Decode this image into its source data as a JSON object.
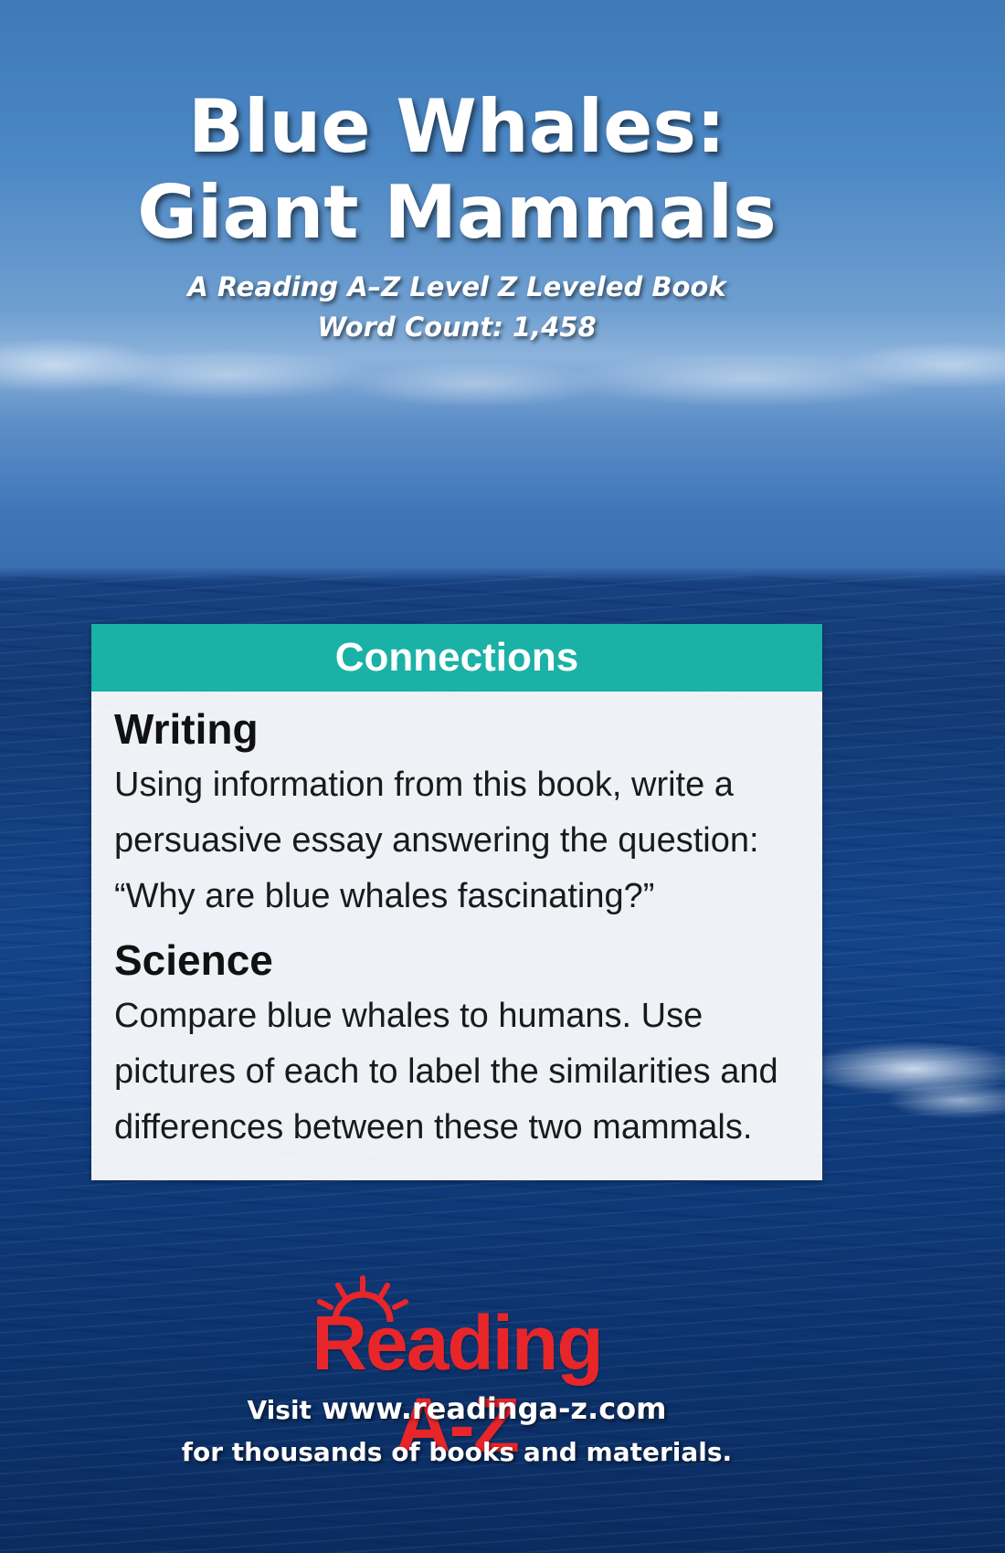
{
  "cover": {
    "title_line1": "Blue Whales:",
    "title_line2": "Giant Mammals",
    "subtitle_line1": "A Reading A–Z Level Z Leveled Book",
    "subtitle_line2": "Word Count: 1,458"
  },
  "connections": {
    "header": "Connections",
    "accent_color": "#1ab1a6",
    "sections": [
      {
        "heading": "Writing",
        "text": "Using information from this book, write a persuasive essay answering the question: “Why are blue whales fascinating?”"
      },
      {
        "heading": "Science",
        "text": "Compare blue whales to humans.  Use pictures of each to label the similarities and differences between these two mammals."
      }
    ]
  },
  "footer": {
    "logo_text": "Reading A-Z",
    "logo_color": "#e8262a",
    "visit_label": "Visit",
    "url": "www.readinga-z.com",
    "tagline": "for thousands of books and materials."
  }
}
